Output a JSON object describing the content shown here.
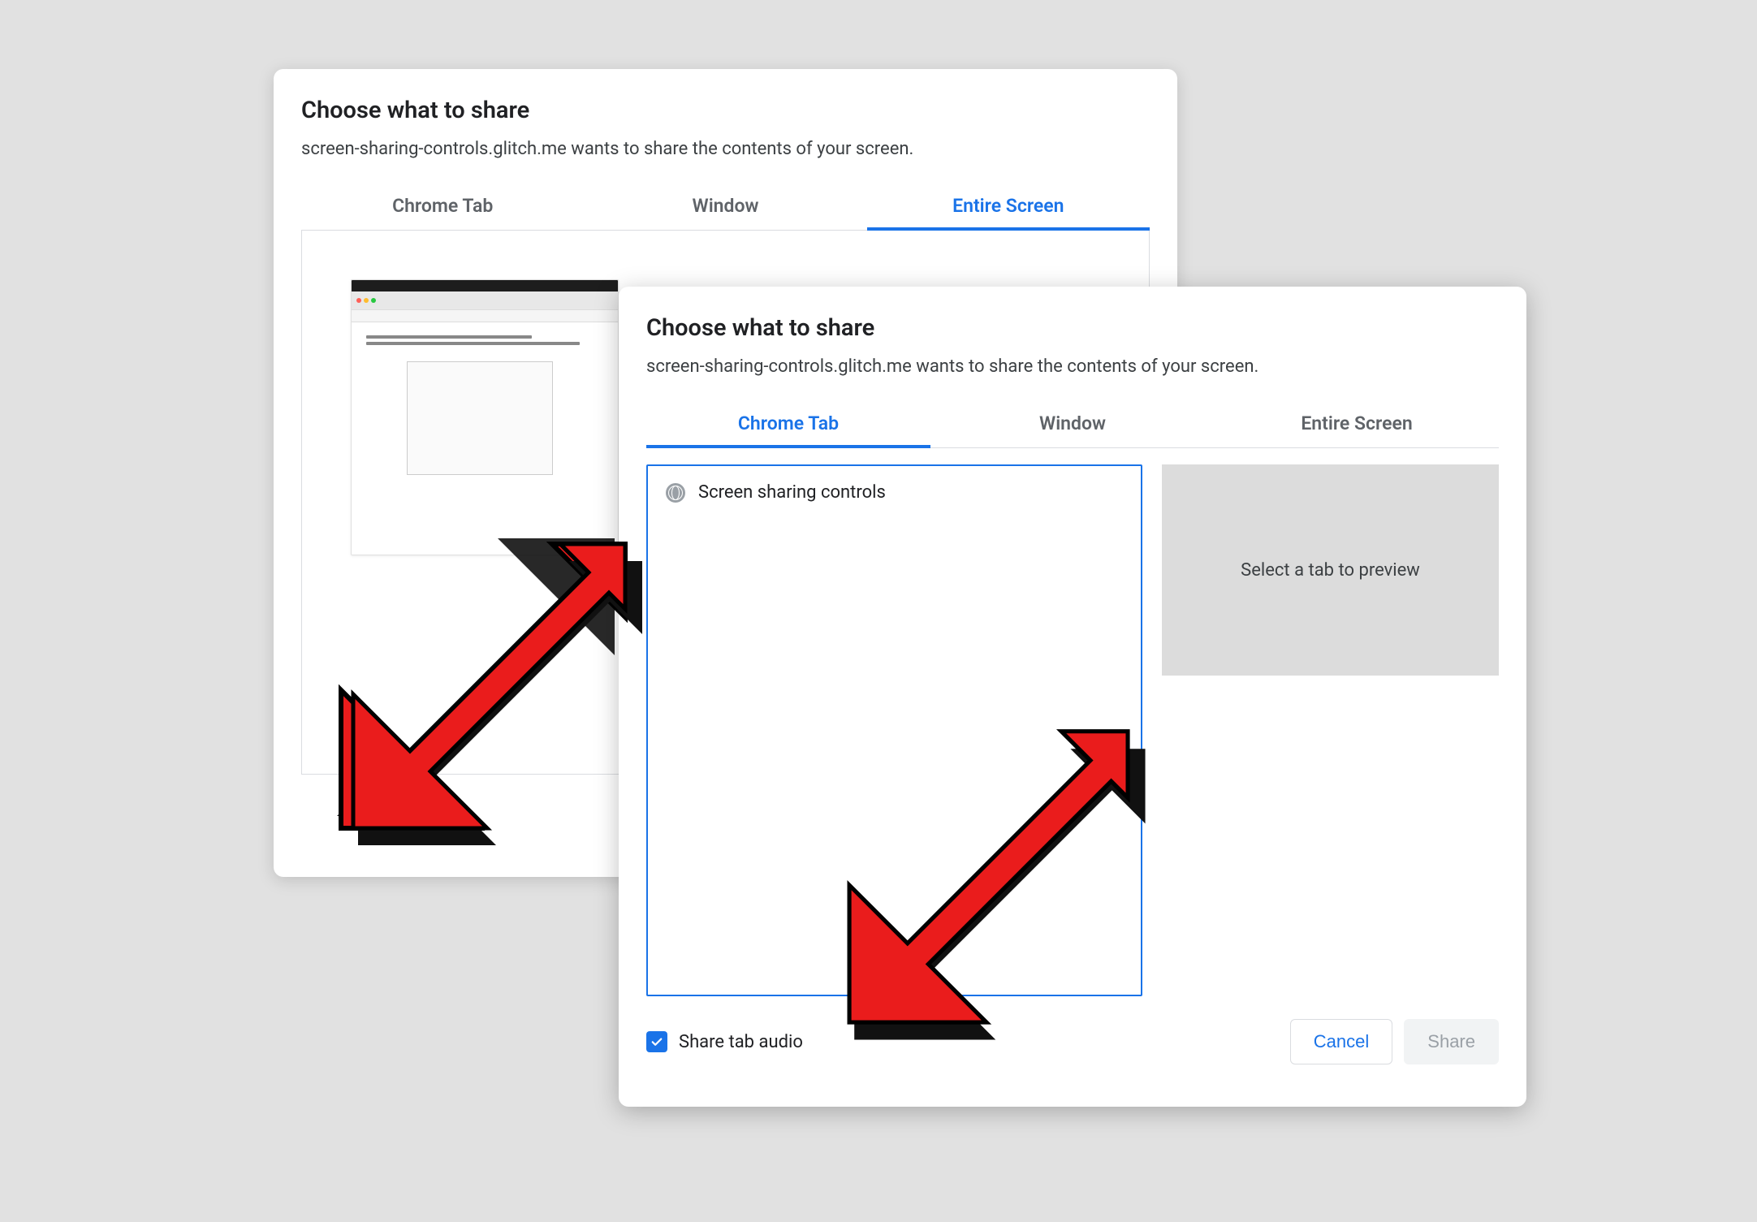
{
  "dialogBack": {
    "title": "Choose what to share",
    "subtitle": "screen-sharing-controls.glitch.me wants to share the contents of your screen.",
    "tabs": {
      "chrome": "Chrome Tab",
      "window": "Window",
      "entire": "Entire Screen"
    }
  },
  "dialogFront": {
    "title": "Choose what to share",
    "subtitle": "screen-sharing-controls.glitch.me wants to share the contents of your screen.",
    "tabs": {
      "chrome": "Chrome Tab",
      "window": "Window",
      "entire": "Entire Screen"
    },
    "tabItems": [
      "Screen sharing controls"
    ],
    "previewPlaceholder": "Select a tab to preview",
    "shareAudioLabel": "Share tab audio",
    "shareAudioChecked": true,
    "buttons": {
      "cancel": "Cancel",
      "share": "Share"
    }
  },
  "colors": {
    "accent": "#1a73e8"
  }
}
